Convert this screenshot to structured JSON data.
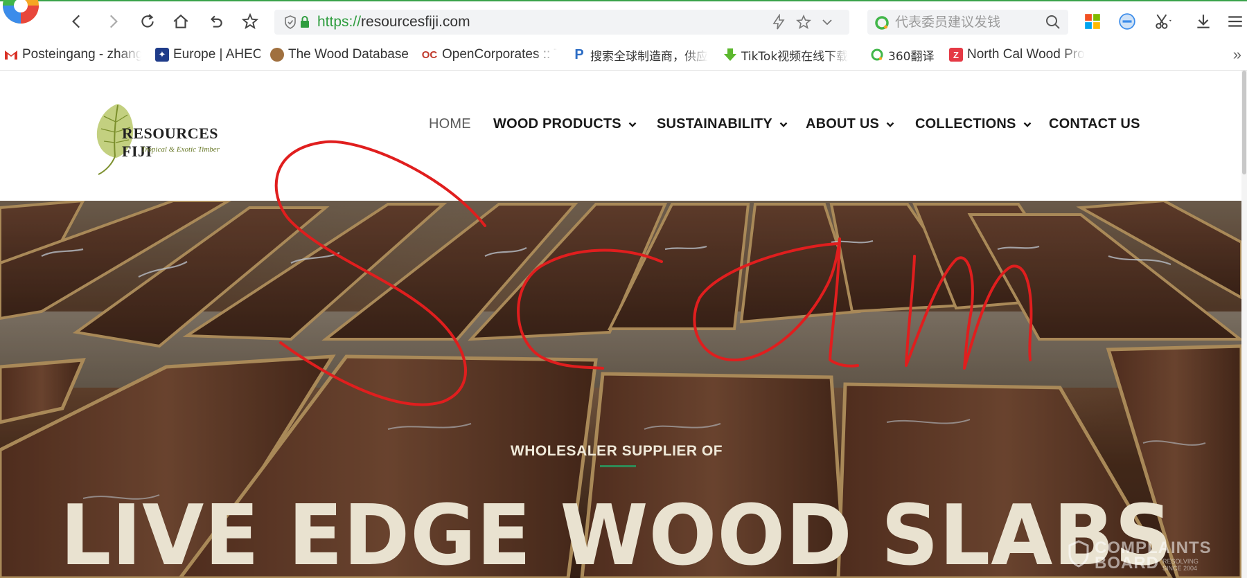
{
  "browser": {
    "url_scheme": "https://",
    "url_host": "resourcesfiji.com",
    "search_placeholder": "代表委员建议发钱"
  },
  "bookmarks": [
    {
      "label": "Posteingang - zhang",
      "icon": "gmail-icon"
    },
    {
      "label": "Europe | AHEC",
      "icon": "ahec-icon"
    },
    {
      "label": "The Wood Database",
      "icon": "wood-database-icon"
    },
    {
      "label": "OpenCorporates :: T",
      "icon": "opencorporates-icon"
    },
    {
      "label": "搜索全球制造商，供应",
      "icon": "p-icon"
    },
    {
      "label": "TikTok视频在线下载",
      "icon": "tiktok-download-icon"
    },
    {
      "label": "360翻译",
      "icon": "translate-360-icon"
    },
    {
      "label": "North Cal Wood Pro",
      "icon": "north-cal-icon"
    }
  ],
  "site": {
    "brand_name": "RESOURCES FIJI",
    "brand_tagline": "Tropical & Exotic Timber",
    "nav": [
      {
        "label": "HOME",
        "active": true,
        "dropdown": false
      },
      {
        "label": "WOOD PRODUCTS",
        "active": false,
        "dropdown": true
      },
      {
        "label": "SUSTAINABILITY",
        "active": false,
        "dropdown": true
      },
      {
        "label": "ABOUT US",
        "active": false,
        "dropdown": true
      },
      {
        "label": "COLLECTIONS",
        "active": false,
        "dropdown": true
      },
      {
        "label": "CONTACT US",
        "active": false,
        "dropdown": false
      }
    ]
  },
  "hero": {
    "subtitle": "WHOLESALER SUPPLIER OF",
    "title": "LIVE EDGE WOOD SLABS",
    "accent_color": "#2e8b57"
  },
  "watermark": {
    "line1": "COMPLAINTS",
    "line2": "BOARD",
    "tagline": "RESOLVING SINCE 2004"
  },
  "colors": {
    "secure_green": "#2f9d3f",
    "annotation_red": "#e01e1e"
  }
}
